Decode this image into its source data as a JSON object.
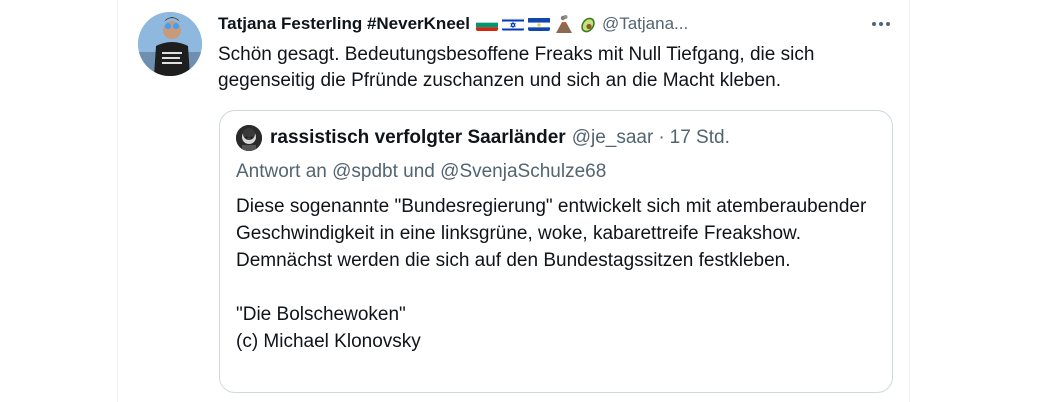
{
  "tweet": {
    "display_name": "Tatjana Festerling #NeverKneel",
    "flags": [
      "bulgaria-flag-icon",
      "israel-flag-icon",
      "el-salvador-flag-icon",
      "volcano-icon",
      "avocado-icon"
    ],
    "handle": "@Tatjana...",
    "text": "Schön gesagt. Bedeutungsbesoffene Freaks mit Null Tiefgang, die sich gegenseitig die Pfründe zuschanzen und sich an die Macht kleben."
  },
  "quote": {
    "display_name": "rassistisch verfolgter Saarländer",
    "handle": "@je_saar",
    "separator": "·",
    "time": "17 Std.",
    "reply_prefix": "Antwort an",
    "reply_mention_1": "@spdbt",
    "reply_and": "und",
    "reply_mention_2": "@SvenjaSchulze68",
    "body_paragraph_1": "Diese sogenannte \"Bundesregierung\" entwickelt sich mit atemberaubender Geschwindigkeit in eine linksgrüne, woke, kabarettreife Freakshow. Demnächst werden die sich auf den Bundestagssitzen festkleben.",
    "body_line_2": "\"Die Bolschewoken\"",
    "body_line_3": "(c) Michael Klonovsky"
  },
  "colors": {
    "text": "#0f1419",
    "secondary": "#536471",
    "border": "#cfd9de"
  }
}
